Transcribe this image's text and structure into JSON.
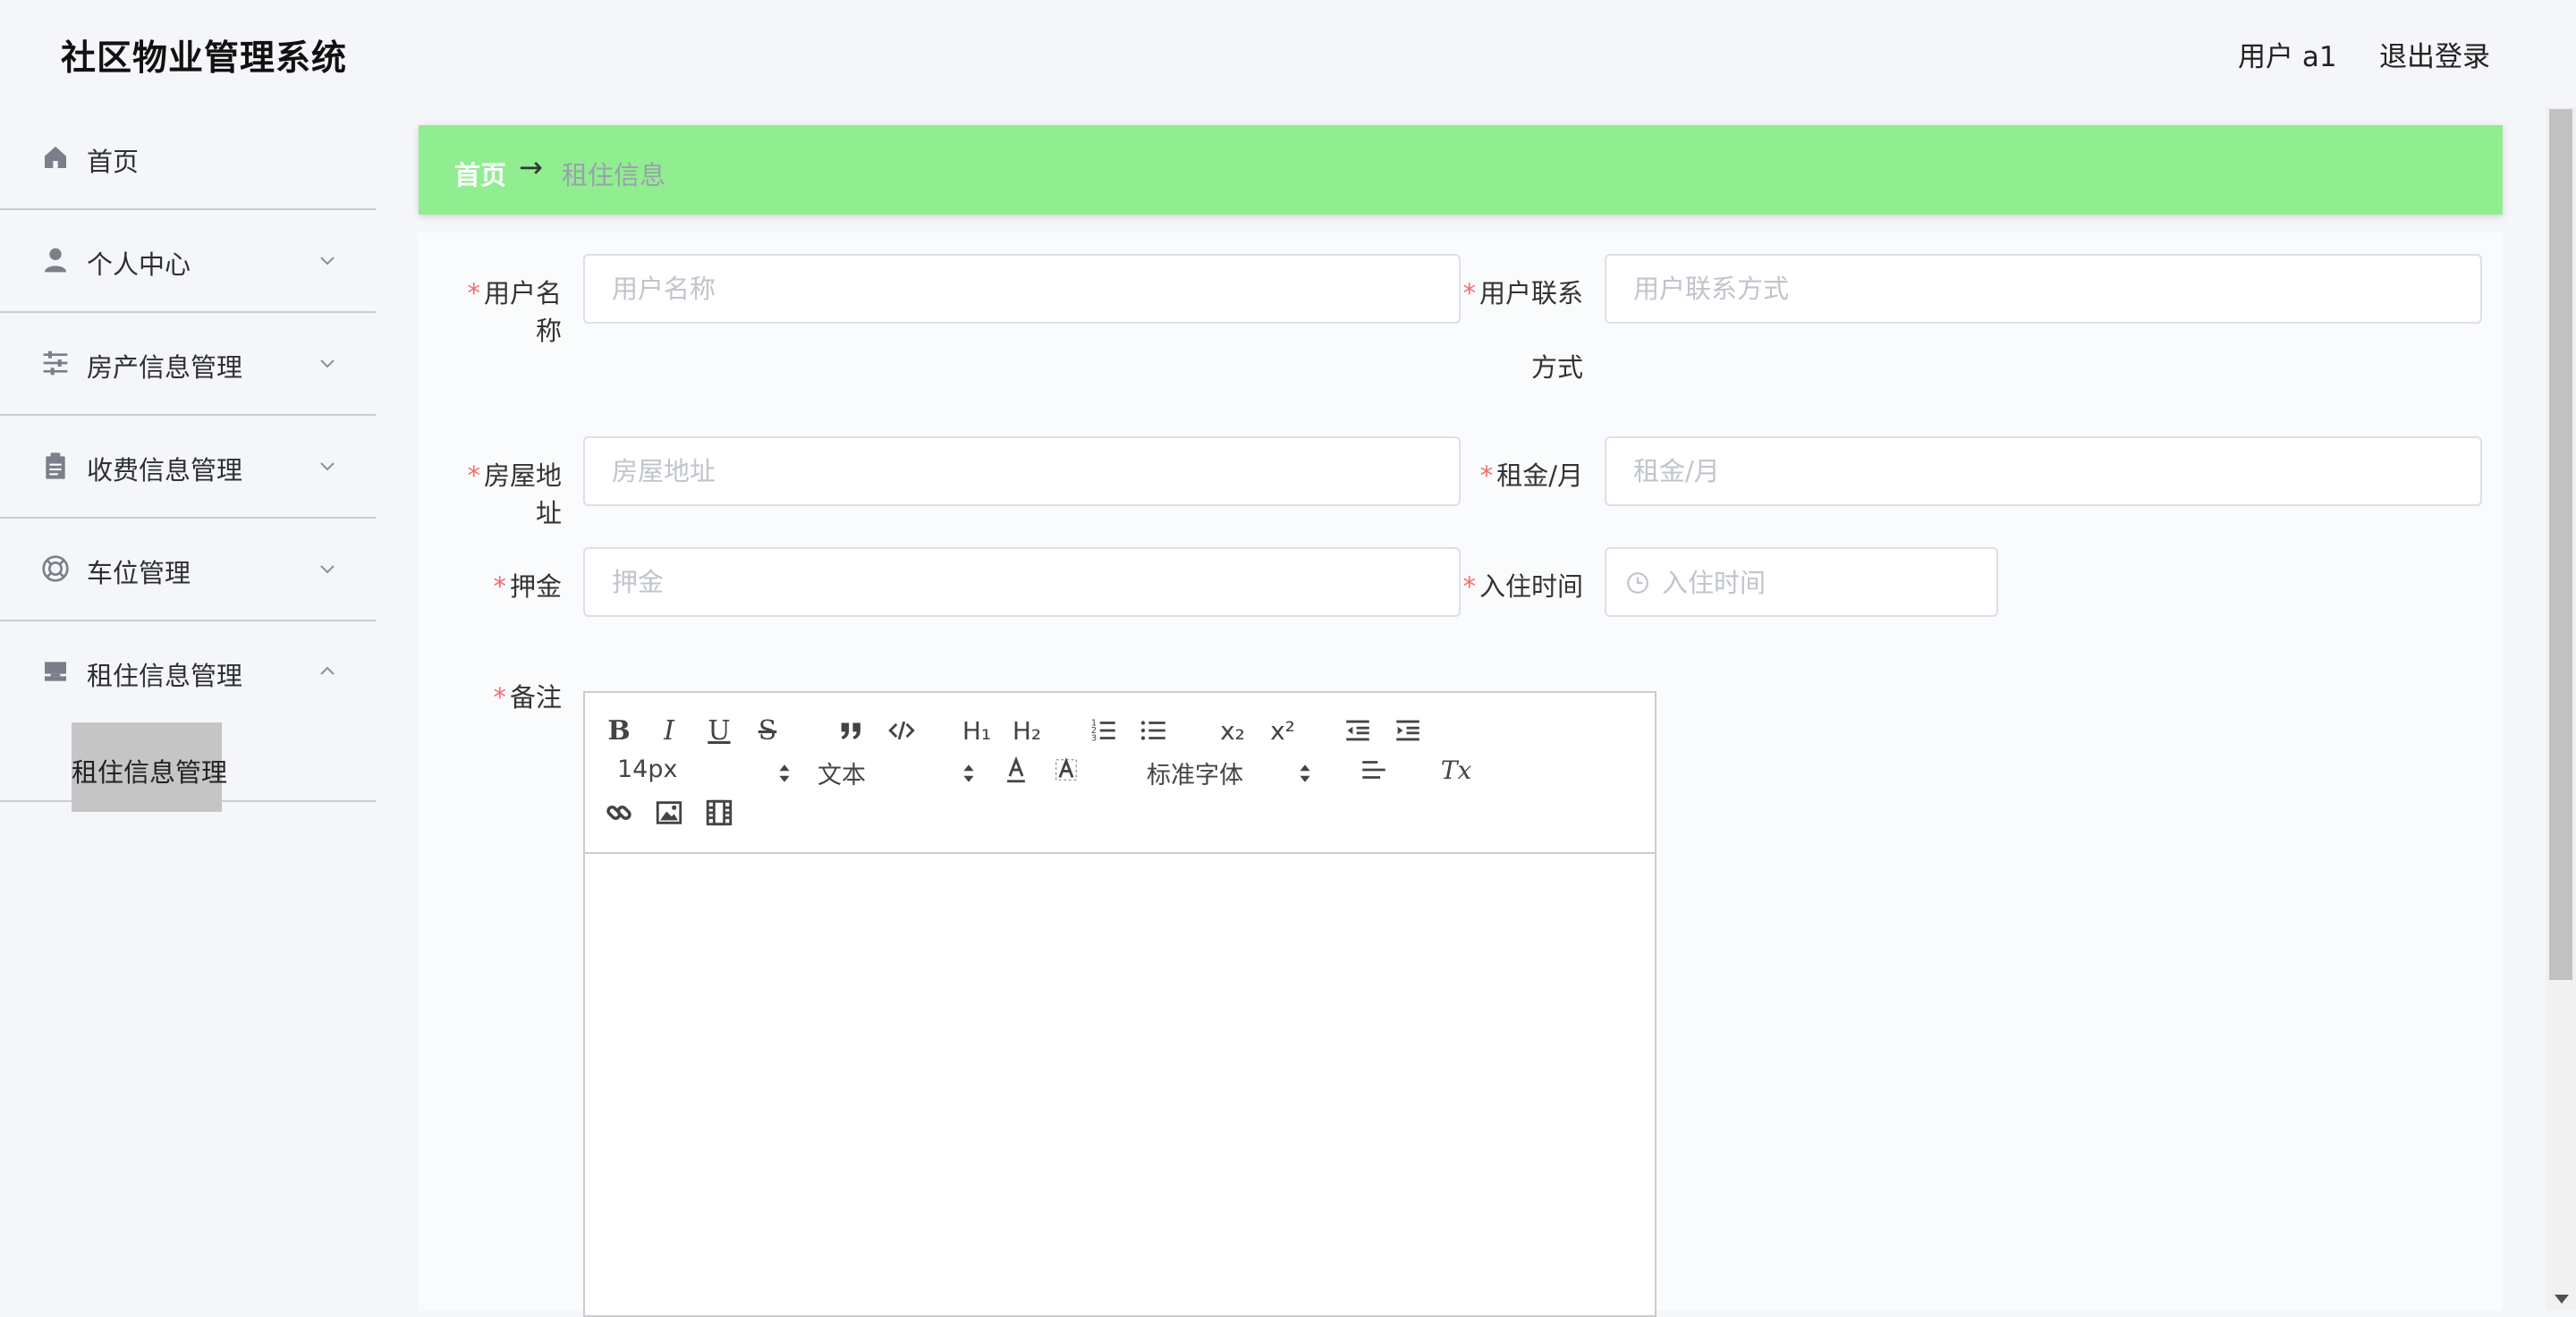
{
  "header": {
    "app_title": "社区物业管理系统",
    "user_label": "用户 a1",
    "logout_label": "退出登录"
  },
  "sidebar": {
    "items": [
      {
        "label": "首页",
        "icon": "home-icon"
      },
      {
        "label": "个人中心",
        "icon": "user-icon"
      },
      {
        "label": "房产信息管理",
        "icon": "sliders-icon"
      },
      {
        "label": "收费信息管理",
        "icon": "clipboard-icon"
      },
      {
        "label": "车位管理",
        "icon": "lifebuoy-icon"
      },
      {
        "label": "租住信息管理",
        "icon": "tray-icon",
        "expanded": true,
        "children": [
          {
            "label": "租住信息管理",
            "active": true
          }
        ]
      }
    ]
  },
  "breadcrumb": {
    "home": "首页",
    "separator": "→",
    "current": "租住信息"
  },
  "form": {
    "username": {
      "label": "用户名称",
      "placeholder": "用户名称",
      "value": ""
    },
    "contact": {
      "label_line1": "用户联系",
      "label_line2": "方式",
      "placeholder": "用户联系方式",
      "value": ""
    },
    "address": {
      "label": "房屋地址",
      "placeholder": "房屋地址",
      "value": ""
    },
    "rent": {
      "label": "租金/月",
      "placeholder": "租金/月",
      "value": ""
    },
    "deposit": {
      "label": "押金",
      "placeholder": "押金",
      "value": ""
    },
    "checkin": {
      "label": "入住时间",
      "placeholder": "入住时间",
      "value": ""
    },
    "remarks": {
      "label": "备注"
    },
    "required_mark": "*"
  },
  "editor": {
    "font_size": "14px",
    "block_format": "文本",
    "font_family": "标准字体",
    "buttons": {
      "bold": "B",
      "italic": "I",
      "underline": "U",
      "strike": "S",
      "h1": "H₁",
      "h2": "H₂",
      "sub": "x₂",
      "sup": "x²",
      "clean": "Tx"
    }
  },
  "colors": {
    "breadcrumb_bg": "#90ee90",
    "required": "#f56c6c",
    "active_submenu": "#c5c5c5"
  }
}
